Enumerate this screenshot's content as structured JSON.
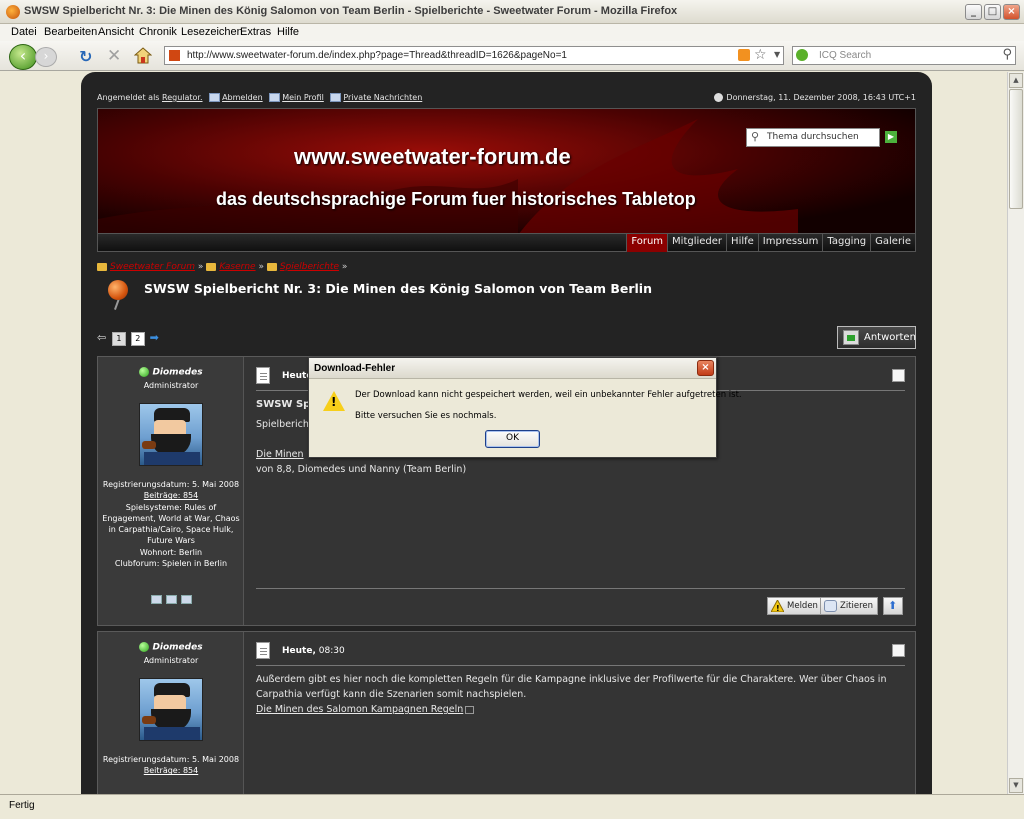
{
  "window": {
    "title": "SWSW Spielbericht Nr. 3: Die Minen des König Salomon von Team Berlin - Spielberichte - Sweetwater Forum - Mozilla Firefox"
  },
  "menu": [
    "Datei",
    "Bearbeiten",
    "Ansicht",
    "Chronik",
    "Lesezeichen",
    "Extras",
    "Hilfe"
  ],
  "nav": {
    "url": "http://www.sweetwater-forum.de/index.php?page=Thread&threadID=1626&pageNo=1",
    "search_placeholder": "ICQ Search"
  },
  "status": "Fertig",
  "forum": {
    "login_prefix": "Angemeldet als",
    "user": "Regulator.",
    "links": [
      "Abmelden",
      "Mein Profil",
      "Private Nachrichten"
    ],
    "datetime": "Donnerstag, 11. Dezember 2008, 16:43 UTC+1",
    "banner_title": "www.sweetwater-forum.de",
    "banner_subtitle": "das deutschsprachige Forum fuer historisches Tabletop",
    "search_placeholder": "Thema durchsuchen",
    "tabs": [
      "Forum",
      "Mitglieder",
      "Hilfe",
      "Impressum",
      "Tagging",
      "Galerie"
    ],
    "breadcrumbs": [
      "Sweetwater Forum",
      "Kaserne",
      "Spielberichte"
    ],
    "crumb_sep": "»",
    "thread_title": "SWSW Spielbericht Nr. 3: Die Minen des König Salomon von Team Berlin",
    "pages": [
      "1",
      "2"
    ],
    "reply_label": "Antworten"
  },
  "posts": [
    {
      "author": "Diomedes",
      "rank": "Administrator",
      "reg": "Registrierungsdatum: 5. Mai 2008",
      "posts": "Beiträge: 854",
      "systems": "Spielsysteme: Rules of Engagement, World at War, Chaos in Carpathia/Cairo, Space Hulk, Future Wars",
      "location": "Wohnort: Berlin",
      "club": "Clubforum: Spielen in Berlin",
      "date_label": "Heute",
      "date_time": "",
      "title": "SWSW Spi",
      "line1": "Spielbericht",
      "link": "Die Minen",
      "line3": "von 8,8, Diomedes und Nanny (Team Berlin)",
      "btn_report": "Melden",
      "btn_quote": "Zitieren"
    },
    {
      "author": "Diomedes",
      "rank": "Administrator",
      "reg": "Registrierungsdatum: 5. Mai 2008",
      "posts": "Beiträge: 854",
      "date_label": "Heute,",
      "date_time": "08:30",
      "body": "Außerdem gibt es hier noch die kompletten Regeln für die Kampagne inklusive der Profilwerte für die Charaktere. Wer über Chaos in Carpathia verfügt kann die Szenarien somit nachspielen.",
      "link": "Die Minen des Salomon Kampagnen Regeln"
    }
  ],
  "dialog": {
    "title": "Download-Fehler",
    "message": "Der Download kann nicht gespeichert werden, weil ein unbekannter Fehler aufgetreten ist.",
    "retry": "Bitte versuchen Sie es nochmals.",
    "ok": "OK"
  }
}
